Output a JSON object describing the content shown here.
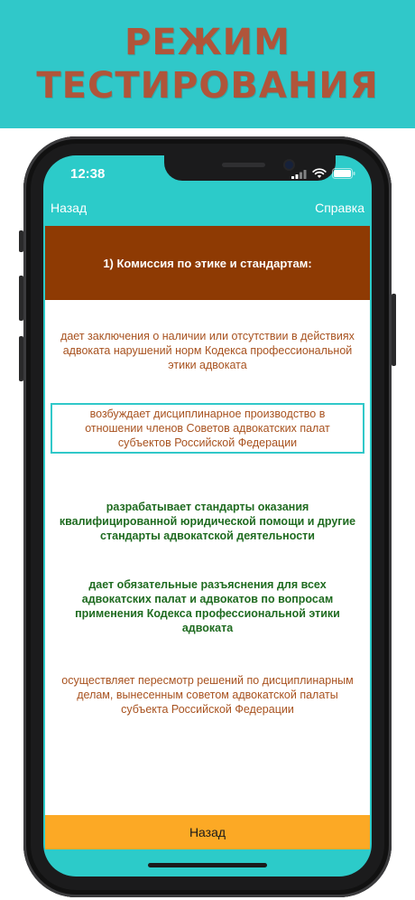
{
  "banner": {
    "line1": "РЕЖИМ",
    "line2": "ТЕСТИРОВАНИЯ"
  },
  "status_bar": {
    "time": "12:38"
  },
  "nav": {
    "back_label": "Назад",
    "help_label": "Справка"
  },
  "question": {
    "text": "1) Комиссия по этике и стандартам:"
  },
  "answers": [
    {
      "text": "дает заключения о наличии или отсутствии в действиях адвоката нарушений норм Кодекса профессиональной этики адвоката",
      "color": "#a8521f"
    },
    {
      "text": "возбуждает дисциплинарное производство в отношении членов Советов адвокатских палат субъектов Российской Федерации",
      "color": "#a8521f",
      "selected": true
    },
    {
      "text": "разрабатывает стандарты оказания квалифицированной юридической помощи и другие стандарты адвокатской деятельности",
      "color": "#1f6b20"
    },
    {
      "text": "дает обязательные разъяснения для всех адвокатских палат и адвокатов по вопросам применения Кодекса профессиональной этики адвоката",
      "color": "#1f6b20"
    },
    {
      "text": "осуществляет пересмотр решений по дисциплинарным делам, вынесенным советом адвокатской палаты субъекта Российской Федерации",
      "color": "#a8521f"
    }
  ],
  "bottom_button": {
    "label": "Назад"
  },
  "colors": {
    "accent_teal": "#30c8c9",
    "question_bg": "#8e3a03",
    "bottom_button_bg": "#fca925",
    "banner_text": "#b0553a"
  },
  "icons": [
    "signal-icon",
    "wifi-icon",
    "battery-icon"
  ]
}
